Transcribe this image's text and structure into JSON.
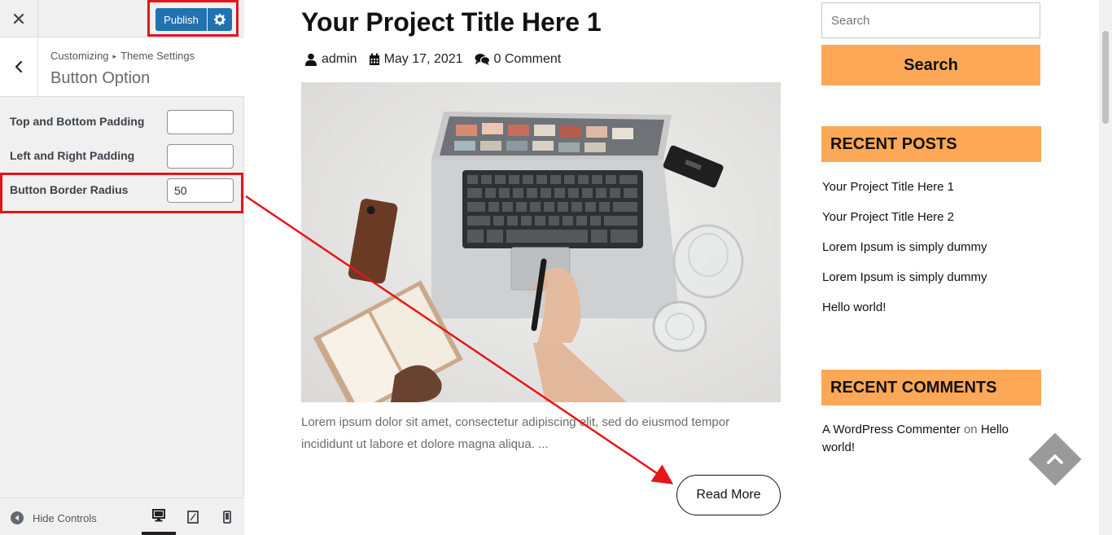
{
  "customizer": {
    "close_icon": "close-icon",
    "publish_label": "Publish",
    "breadcrumb": {
      "root": "Customizing",
      "parent": "Theme Settings"
    },
    "section_title": "Button Option",
    "options": [
      {
        "label": "Top and Bottom Padding",
        "value": ""
      },
      {
        "label": "Left and Right Padding",
        "value": ""
      },
      {
        "label": "Button Border Radius",
        "value": "50"
      }
    ],
    "footer": {
      "hide_controls": "Hide Controls",
      "devices": [
        "desktop",
        "tablet",
        "mobile"
      ],
      "active_device": "desktop"
    }
  },
  "post": {
    "title": "Your Project Title Here 1",
    "author": "admin",
    "date": "May 17, 2021",
    "comments": "0 Comment",
    "excerpt": "Lorem ipsum dolor sit amet, consectetur adipiscing elit, sed do eiusmod tempor incididunt ut labore et dolore magna aliqua. ...",
    "read_more": "Read More"
  },
  "sidebar": {
    "search_placeholder": "Search",
    "search_button": "Search",
    "recent_posts_title": "RECENT POSTS",
    "recent_posts": [
      "Your Project Title Here 1",
      "Your Project Title Here 2",
      "Lorem Ipsum is simply dummy",
      "Lorem Ipsum is simply dummy",
      "Hello world!"
    ],
    "recent_comments_title": "RECENT COMMENTS",
    "recent_comment": {
      "author": "A WordPress Commenter",
      "on": "on",
      "post": "Hello world!"
    }
  },
  "colors": {
    "publish_blue": "#2271b1",
    "accent_orange": "#fda856",
    "annotation_red": "#e5151a"
  }
}
